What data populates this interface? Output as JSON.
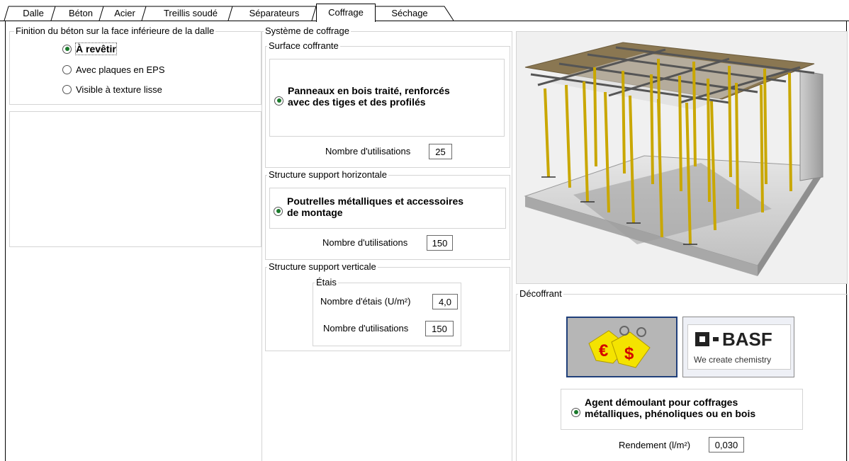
{
  "tabs": [
    {
      "label": "Dalle"
    },
    {
      "label": "Béton"
    },
    {
      "label": "Acier"
    },
    {
      "label": "Treillis soudé"
    },
    {
      "label": "Séparateurs"
    },
    {
      "label": "Coffrage"
    },
    {
      "label": "Séchage"
    }
  ],
  "active_tab": "Coffrage",
  "finition": {
    "title": "Finition du béton sur la face inférieure de la dalle",
    "options": [
      "À revêtir",
      "Avec plaques en EPS",
      "Visible à texture lisse"
    ],
    "selected": "À revêtir"
  },
  "systeme": {
    "title": "Système de coffrage",
    "surface": {
      "title": "Surface coffrante",
      "option_line1": "Panneaux en bois traité, renforcés",
      "option_line2": "avec des tiges et des profilés",
      "uses_label": "Nombre d'utilisations",
      "uses_value": "25"
    },
    "horizontal": {
      "title": "Structure support horizontale",
      "option_line1": "Poutrelles métalliques et accessoires",
      "option_line2": "de montage",
      "uses_label": "Nombre d'utilisations",
      "uses_value": "150"
    },
    "vertical": {
      "title": "Structure support verticale",
      "etais": {
        "title": "Étais",
        "count_label": "Nombre d'étais (U/m²)",
        "count_value": "4,0",
        "uses_label": "Nombre d'utilisations",
        "uses_value": "150"
      }
    }
  },
  "decoffrant": {
    "title": "Décoffrant",
    "price_button_symbols": [
      "€",
      "$"
    ],
    "basf_logo": "BASF",
    "basf_tagline": "We create chemistry",
    "option_line1": "Agent démoulant pour coffrages",
    "option_line2": "métalliques, phénoliques ou en bois",
    "rendement_label": "Rendement (l/m²)",
    "rendement_value": "0,030"
  },
  "colors": {
    "radio_dot": "#1a7a2b",
    "price_tag": "#f4e300",
    "euro": "#d40000",
    "basf_dark": "#222222"
  }
}
